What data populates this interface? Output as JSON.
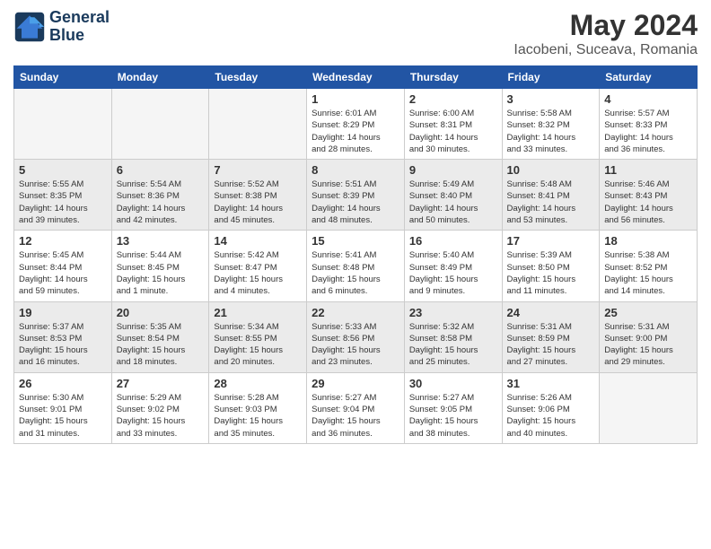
{
  "logo": {
    "line1": "General",
    "line2": "Blue"
  },
  "title": "May 2024",
  "subtitle": "Iacobeni, Suceava, Romania",
  "weekdays": [
    "Sunday",
    "Monday",
    "Tuesday",
    "Wednesday",
    "Thursday",
    "Friday",
    "Saturday"
  ],
  "weeks": [
    [
      {
        "day": "",
        "info": ""
      },
      {
        "day": "",
        "info": ""
      },
      {
        "day": "",
        "info": ""
      },
      {
        "day": "1",
        "info": "Sunrise: 6:01 AM\nSunset: 8:29 PM\nDaylight: 14 hours\nand 28 minutes."
      },
      {
        "day": "2",
        "info": "Sunrise: 6:00 AM\nSunset: 8:31 PM\nDaylight: 14 hours\nand 30 minutes."
      },
      {
        "day": "3",
        "info": "Sunrise: 5:58 AM\nSunset: 8:32 PM\nDaylight: 14 hours\nand 33 minutes."
      },
      {
        "day": "4",
        "info": "Sunrise: 5:57 AM\nSunset: 8:33 PM\nDaylight: 14 hours\nand 36 minutes."
      }
    ],
    [
      {
        "day": "5",
        "info": "Sunrise: 5:55 AM\nSunset: 8:35 PM\nDaylight: 14 hours\nand 39 minutes."
      },
      {
        "day": "6",
        "info": "Sunrise: 5:54 AM\nSunset: 8:36 PM\nDaylight: 14 hours\nand 42 minutes."
      },
      {
        "day": "7",
        "info": "Sunrise: 5:52 AM\nSunset: 8:38 PM\nDaylight: 14 hours\nand 45 minutes."
      },
      {
        "day": "8",
        "info": "Sunrise: 5:51 AM\nSunset: 8:39 PM\nDaylight: 14 hours\nand 48 minutes."
      },
      {
        "day": "9",
        "info": "Sunrise: 5:49 AM\nSunset: 8:40 PM\nDaylight: 14 hours\nand 50 minutes."
      },
      {
        "day": "10",
        "info": "Sunrise: 5:48 AM\nSunset: 8:41 PM\nDaylight: 14 hours\nand 53 minutes."
      },
      {
        "day": "11",
        "info": "Sunrise: 5:46 AM\nSunset: 8:43 PM\nDaylight: 14 hours\nand 56 minutes."
      }
    ],
    [
      {
        "day": "12",
        "info": "Sunrise: 5:45 AM\nSunset: 8:44 PM\nDaylight: 14 hours\nand 59 minutes."
      },
      {
        "day": "13",
        "info": "Sunrise: 5:44 AM\nSunset: 8:45 PM\nDaylight: 15 hours\nand 1 minute."
      },
      {
        "day": "14",
        "info": "Sunrise: 5:42 AM\nSunset: 8:47 PM\nDaylight: 15 hours\nand 4 minutes."
      },
      {
        "day": "15",
        "info": "Sunrise: 5:41 AM\nSunset: 8:48 PM\nDaylight: 15 hours\nand 6 minutes."
      },
      {
        "day": "16",
        "info": "Sunrise: 5:40 AM\nSunset: 8:49 PM\nDaylight: 15 hours\nand 9 minutes."
      },
      {
        "day": "17",
        "info": "Sunrise: 5:39 AM\nSunset: 8:50 PM\nDaylight: 15 hours\nand 11 minutes."
      },
      {
        "day": "18",
        "info": "Sunrise: 5:38 AM\nSunset: 8:52 PM\nDaylight: 15 hours\nand 14 minutes."
      }
    ],
    [
      {
        "day": "19",
        "info": "Sunrise: 5:37 AM\nSunset: 8:53 PM\nDaylight: 15 hours\nand 16 minutes."
      },
      {
        "day": "20",
        "info": "Sunrise: 5:35 AM\nSunset: 8:54 PM\nDaylight: 15 hours\nand 18 minutes."
      },
      {
        "day": "21",
        "info": "Sunrise: 5:34 AM\nSunset: 8:55 PM\nDaylight: 15 hours\nand 20 minutes."
      },
      {
        "day": "22",
        "info": "Sunrise: 5:33 AM\nSunset: 8:56 PM\nDaylight: 15 hours\nand 23 minutes."
      },
      {
        "day": "23",
        "info": "Sunrise: 5:32 AM\nSunset: 8:58 PM\nDaylight: 15 hours\nand 25 minutes."
      },
      {
        "day": "24",
        "info": "Sunrise: 5:31 AM\nSunset: 8:59 PM\nDaylight: 15 hours\nand 27 minutes."
      },
      {
        "day": "25",
        "info": "Sunrise: 5:31 AM\nSunset: 9:00 PM\nDaylight: 15 hours\nand 29 minutes."
      }
    ],
    [
      {
        "day": "26",
        "info": "Sunrise: 5:30 AM\nSunset: 9:01 PM\nDaylight: 15 hours\nand 31 minutes."
      },
      {
        "day": "27",
        "info": "Sunrise: 5:29 AM\nSunset: 9:02 PM\nDaylight: 15 hours\nand 33 minutes."
      },
      {
        "day": "28",
        "info": "Sunrise: 5:28 AM\nSunset: 9:03 PM\nDaylight: 15 hours\nand 35 minutes."
      },
      {
        "day": "29",
        "info": "Sunrise: 5:27 AM\nSunset: 9:04 PM\nDaylight: 15 hours\nand 36 minutes."
      },
      {
        "day": "30",
        "info": "Sunrise: 5:27 AM\nSunset: 9:05 PM\nDaylight: 15 hours\nand 38 minutes."
      },
      {
        "day": "31",
        "info": "Sunrise: 5:26 AM\nSunset: 9:06 PM\nDaylight: 15 hours\nand 40 minutes."
      },
      {
        "day": "",
        "info": ""
      }
    ]
  ]
}
